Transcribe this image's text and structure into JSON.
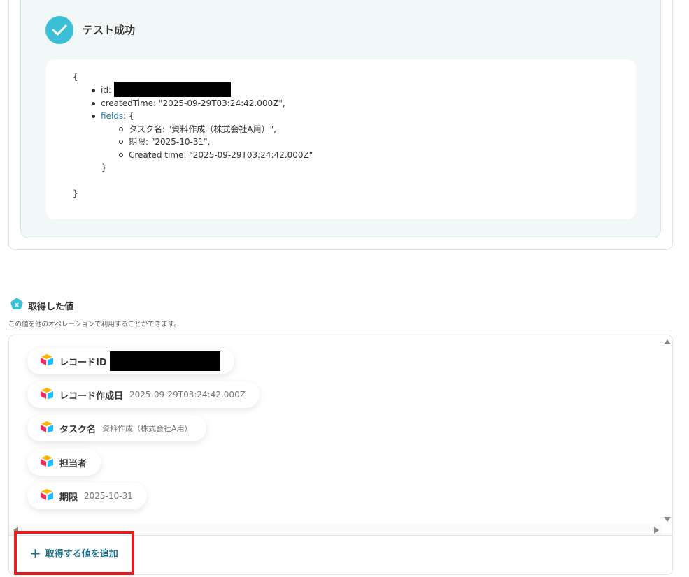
{
  "test_result": {
    "title": "テスト成功",
    "json_open": "{",
    "json_close": "}",
    "id_key": "id:",
    "created_time": "createdTime: \"2025-09-29T03:24:42.000Z\",",
    "fields_key": "fields",
    "fields_open": ": {",
    "fields_items": [
      "タスク名: \"資料作成（株式会社A用）\",",
      "期限: \"2025-10-31\",",
      "Created time: \"2025-09-29T03:24:42.000Z\""
    ],
    "fields_close": "}"
  },
  "acquired_values": {
    "title": "取得した値",
    "description": "この値を他のオペレーションで利用することができます。",
    "items": [
      {
        "label": "レコードID",
        "value": ""
      },
      {
        "label": "レコード作成日",
        "value": "2025-09-29T03:24:42.000Z"
      },
      {
        "label": "タスク名",
        "value": "資料作成（株式会社A用）"
      },
      {
        "label": "担当者",
        "value": ""
      },
      {
        "label": "期限",
        "value": "2025-10-31"
      }
    ],
    "add_button_label": "取得する値を追加"
  },
  "icons": {
    "success": "check-icon",
    "section": "variable-pentagon-icon",
    "chip": "airtable-icon",
    "add": "plus-icon"
  },
  "colors": {
    "accent": "#3bbfd6",
    "link": "#2a7fb8",
    "button_text": "#1f6e86",
    "highlight_border": "#e11d1d"
  }
}
